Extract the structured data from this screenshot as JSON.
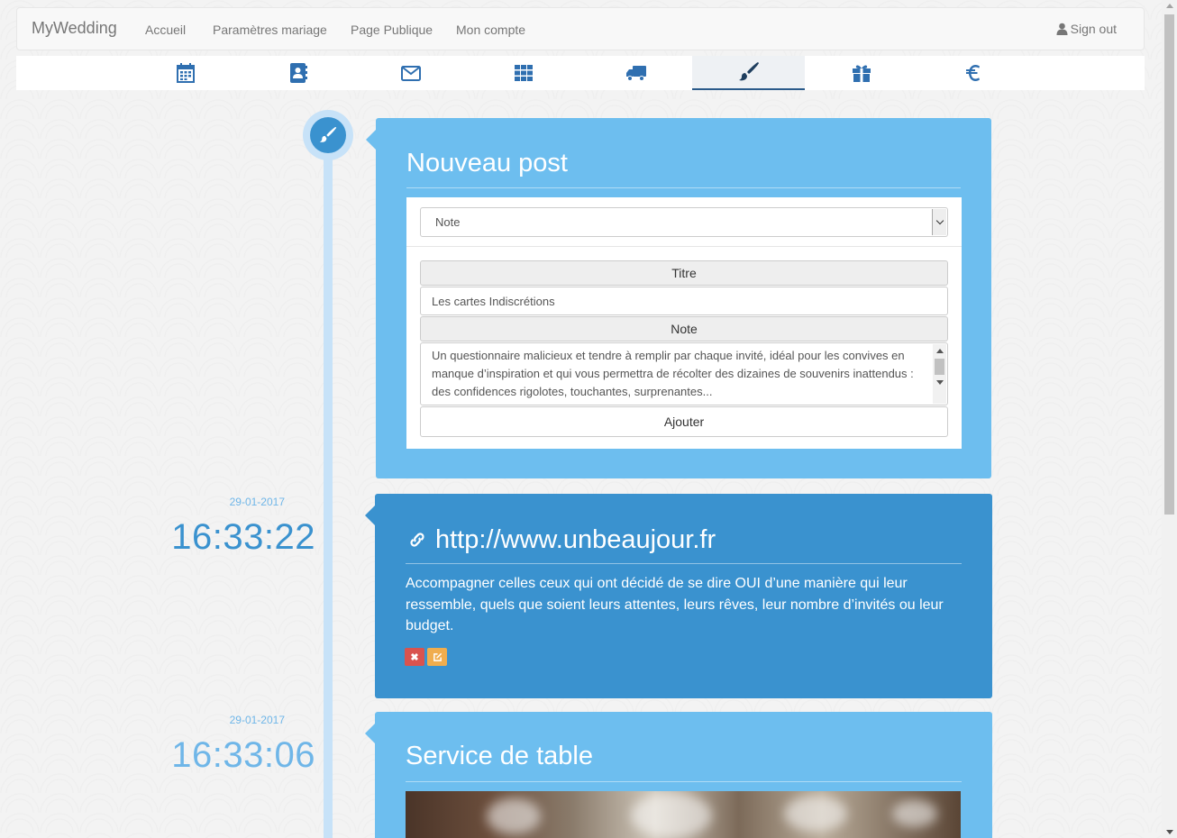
{
  "navbar": {
    "brand": "MyWedding",
    "links": [
      "Accueil",
      "Paramètres mariage",
      "Page Publique",
      "Mon compte"
    ],
    "signout": "Sign out"
  },
  "tabs": [
    {
      "icon": "calendar-icon"
    },
    {
      "icon": "contacts-book-icon"
    },
    {
      "icon": "envelope-icon"
    },
    {
      "icon": "grid-icon"
    },
    {
      "icon": "truck-icon"
    },
    {
      "icon": "paintbrush-icon",
      "active": true
    },
    {
      "icon": "gift-icon"
    },
    {
      "icon": "euro-icon"
    }
  ],
  "timeline": {
    "badge_icon": "paintbrush-icon",
    "posts": [
      {
        "date": "29-01-2017",
        "time": "16:33:22"
      },
      {
        "date": "29-01-2017",
        "time": "16:33:06"
      }
    ]
  },
  "new_post": {
    "title": "Nouveau post",
    "type_select": "Note",
    "title_label": "Titre",
    "title_value": "Les cartes Indiscrétions",
    "note_label": "Note",
    "note_value": "Un questionnaire malicieux et tendre à remplir par chaque invité, idéal pour les convives en manque d’inspiration et qui vous permettra de récolter des dizaines de souvenirs inattendus : des confidences rigolotes, touchantes, surprenantes...",
    "add_button": "Ajouter"
  },
  "post_link": {
    "icon": "link-icon",
    "title": "http://www.unbeaujour.fr",
    "text": "Accompagner celles ceux qui ont décidé de se dire OUI d’une manière qui leur ressemble, quels que soient leurs attentes, leurs rêves, leur nombre d’invités ou leur budget.",
    "delete_icon": "close-icon",
    "edit_icon": "edit-icon"
  },
  "post_image": {
    "title": "Service de table"
  },
  "colors": {
    "card_light": "#6dbeef",
    "card_dark": "#3a92cf",
    "timeline": "#c7e2f8",
    "delete": "#d9534f",
    "edit": "#f0ad4e"
  }
}
